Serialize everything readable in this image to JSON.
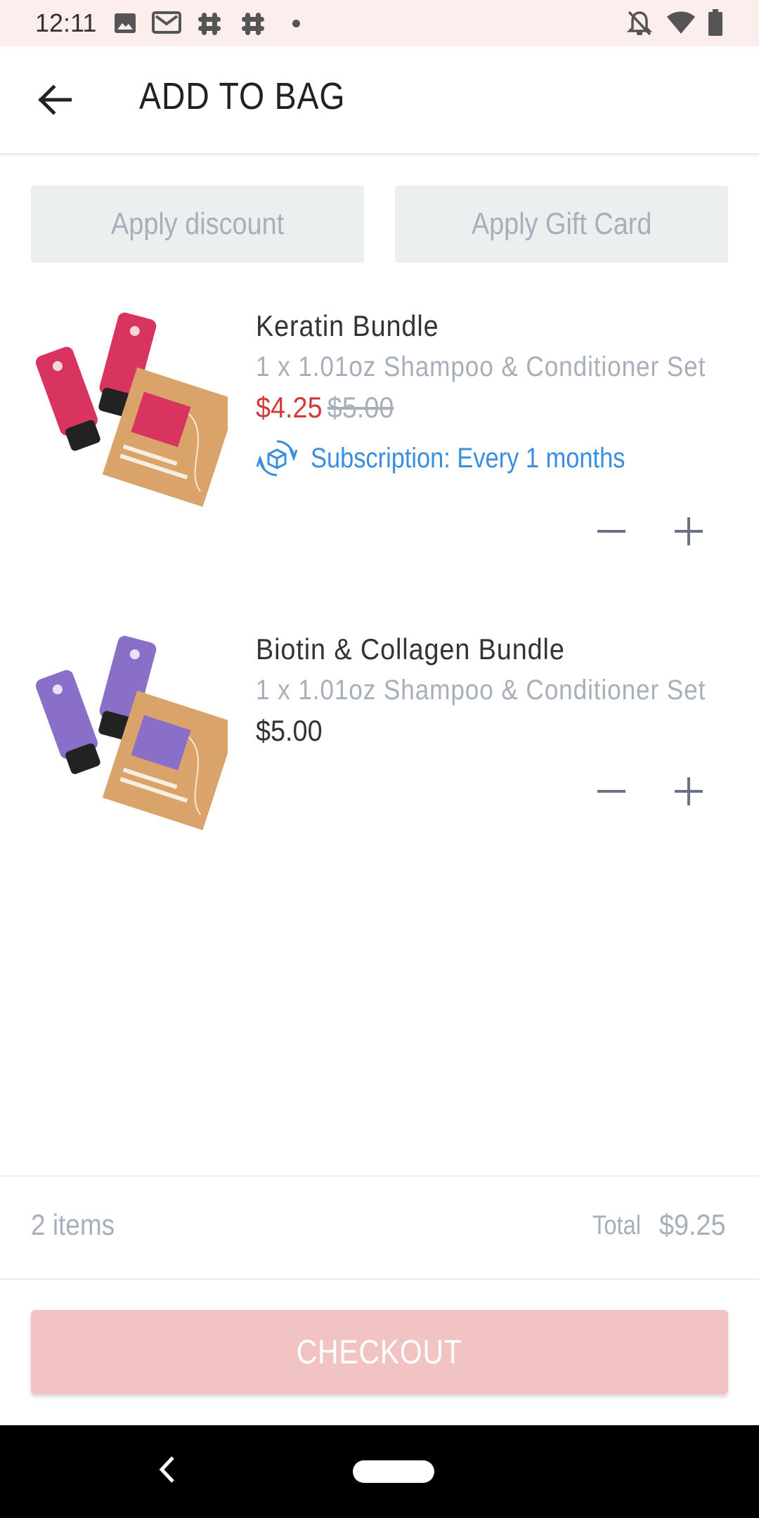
{
  "status_bar": {
    "time": "12:11",
    "icons": [
      "image-icon",
      "gmail-icon",
      "slack-icon",
      "slack-icon",
      "dot-icon",
      "bell-off-icon",
      "wifi-icon",
      "battery-icon"
    ]
  },
  "header": {
    "title": "ADD TO BAG",
    "back_icon": "arrow-left-icon"
  },
  "actions": {
    "discount_label": "Apply discount",
    "gift_card_label": "Apply Gift Card"
  },
  "items": [
    {
      "name": "Keratin Bundle",
      "description": "1 x 1.01oz Shampoo & Conditioner Set",
      "sale_price": "$4.25",
      "original_price": "$5.00",
      "subscription": "Subscription: Every 1 months",
      "accent_color": "#d8345f"
    },
    {
      "name": "Biotin & Collagen Bundle",
      "description": "1 x 1.01oz Shampoo & Conditioner Set",
      "price": "$5.00",
      "accent_color": "#8a6fc9"
    }
  ],
  "summary": {
    "items_count": "2 items",
    "total_label": "Total",
    "total_value": "$9.25"
  },
  "checkout": {
    "label": "CHECKOUT",
    "color": "#f2c3c3"
  },
  "colors": {
    "sale": "#d23a3a",
    "muted": "#a7afbb",
    "link": "#3a8ee0"
  }
}
